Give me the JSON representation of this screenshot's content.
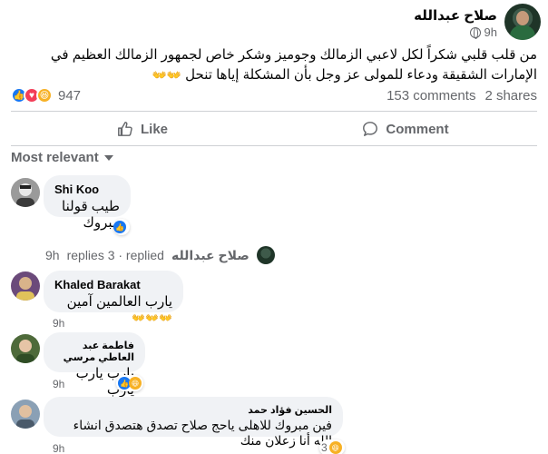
{
  "post": {
    "author": "صلاح عبدالله",
    "time": "9h",
    "text": "من قلب قلبي شكراً لكل لاعبي الزمالك وجوميز وشكر خاص لجمهور الزمالك العظيم في الإمارات الشقيقة ودعاء للمولى عز وجل بأن المشكلة إياها تنحل",
    "text_emoji": "👐👐",
    "reactions_count": "947",
    "comments_count": "153 comments",
    "shares_count": "2 shares"
  },
  "actions": {
    "like_label": "Like",
    "comment_label": "Comment"
  },
  "sort": {
    "label": "Most relevant"
  },
  "comments": [
    {
      "name": "Shi Koo",
      "text": "طيب قولنا مبروك",
      "time": "",
      "reaction_count": ""
    },
    {
      "name": "Khaled Barakat",
      "text": "يارب العالمين آمين",
      "emoji": "👐👐👐",
      "time": "9h",
      "reaction_count": ""
    },
    {
      "name": "فاطمة عبد العاطي مرسي",
      "text": "يارب يارب يارب",
      "time": "9h",
      "reaction_count": ""
    },
    {
      "name": "الحسين فؤاد حمد",
      "text": "فين مبروك للاهلى ياحج صلاح تصدق هتصدق انشاء الله أنا زعلان منك",
      "time": "9h",
      "reaction_count": "3"
    }
  ],
  "replies": {
    "time": "9h",
    "label": "replies 3 · replied",
    "author": "صلاح عبدالله"
  },
  "colors": {
    "like_blue": "#1877f2",
    "love_red": "#f33e58",
    "haha_yellow": "#f7b125",
    "bubble_bg": "#f0f2f5",
    "meta_gray": "#65676b"
  }
}
